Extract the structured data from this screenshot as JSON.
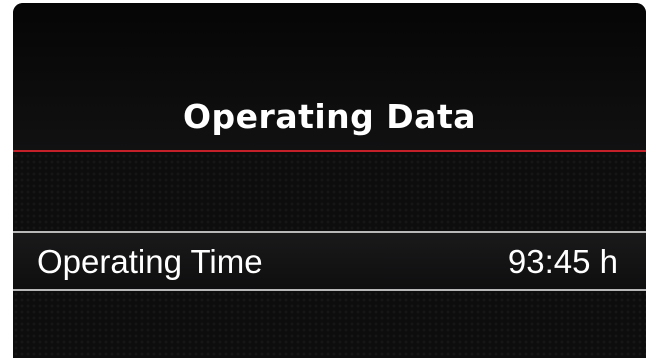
{
  "header": {
    "title": "Operating Data"
  },
  "rows": [
    {
      "label": "Operating Time",
      "value": "93:45 h"
    }
  ],
  "colors": {
    "background": "#0d0d0e",
    "accent_rule": "#c4202a",
    "text": "#ffffff",
    "row_rule": "#b8b8b8"
  }
}
